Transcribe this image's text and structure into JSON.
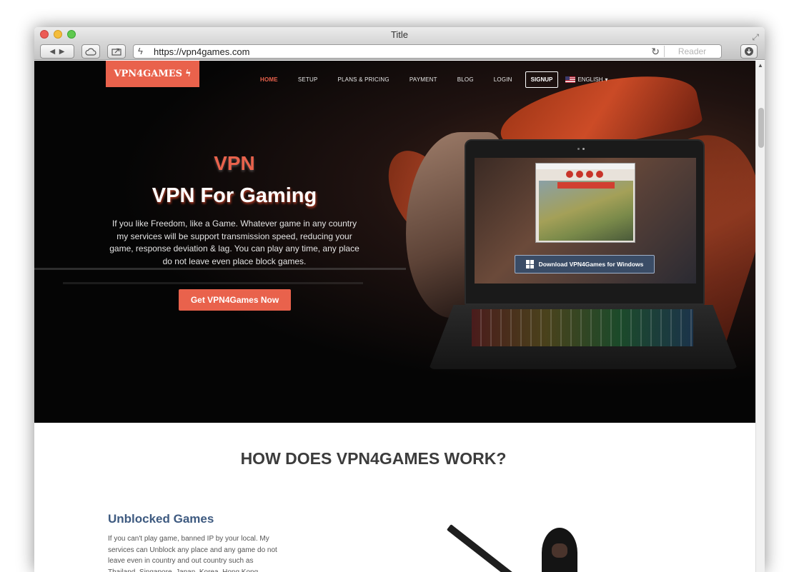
{
  "browser": {
    "title": "Title",
    "url": "https://vpn4games.com",
    "reader_label": "Reader"
  },
  "site": {
    "logo": "VPN4GAMES",
    "nav": [
      "HOME",
      "SETUP",
      "PLANS & PRICING",
      "PAYMENT",
      "BLOG",
      "LOGIN"
    ],
    "signup": "SIGNUP",
    "language": "ENGLISH"
  },
  "hero": {
    "title1": "VPN",
    "title2": "VPN For Gaming",
    "description": "If you like Freedom, like a Game. Whatever game in any country my services will be support transmission speed, reducing your game, response deviation & lag. You can play any time, any place do not leave even place block games.",
    "cta": "Get VPN4Games Now",
    "download": "Download VPN4Games for Windows"
  },
  "section": {
    "title": "HOW DOES VPN4GAMES WORK?"
  },
  "feature": {
    "title": "Unblocked Games",
    "description": "If you can't play game, banned IP by your local. My services can Unblock any place and any game do not leave even in country and out country such as Thailand, Singapore, Japan, Korea, Hong Kong..."
  },
  "colors": {
    "accent": "#e9624c",
    "feature_title": "#3e5a80",
    "hero_bg": "#050505"
  }
}
